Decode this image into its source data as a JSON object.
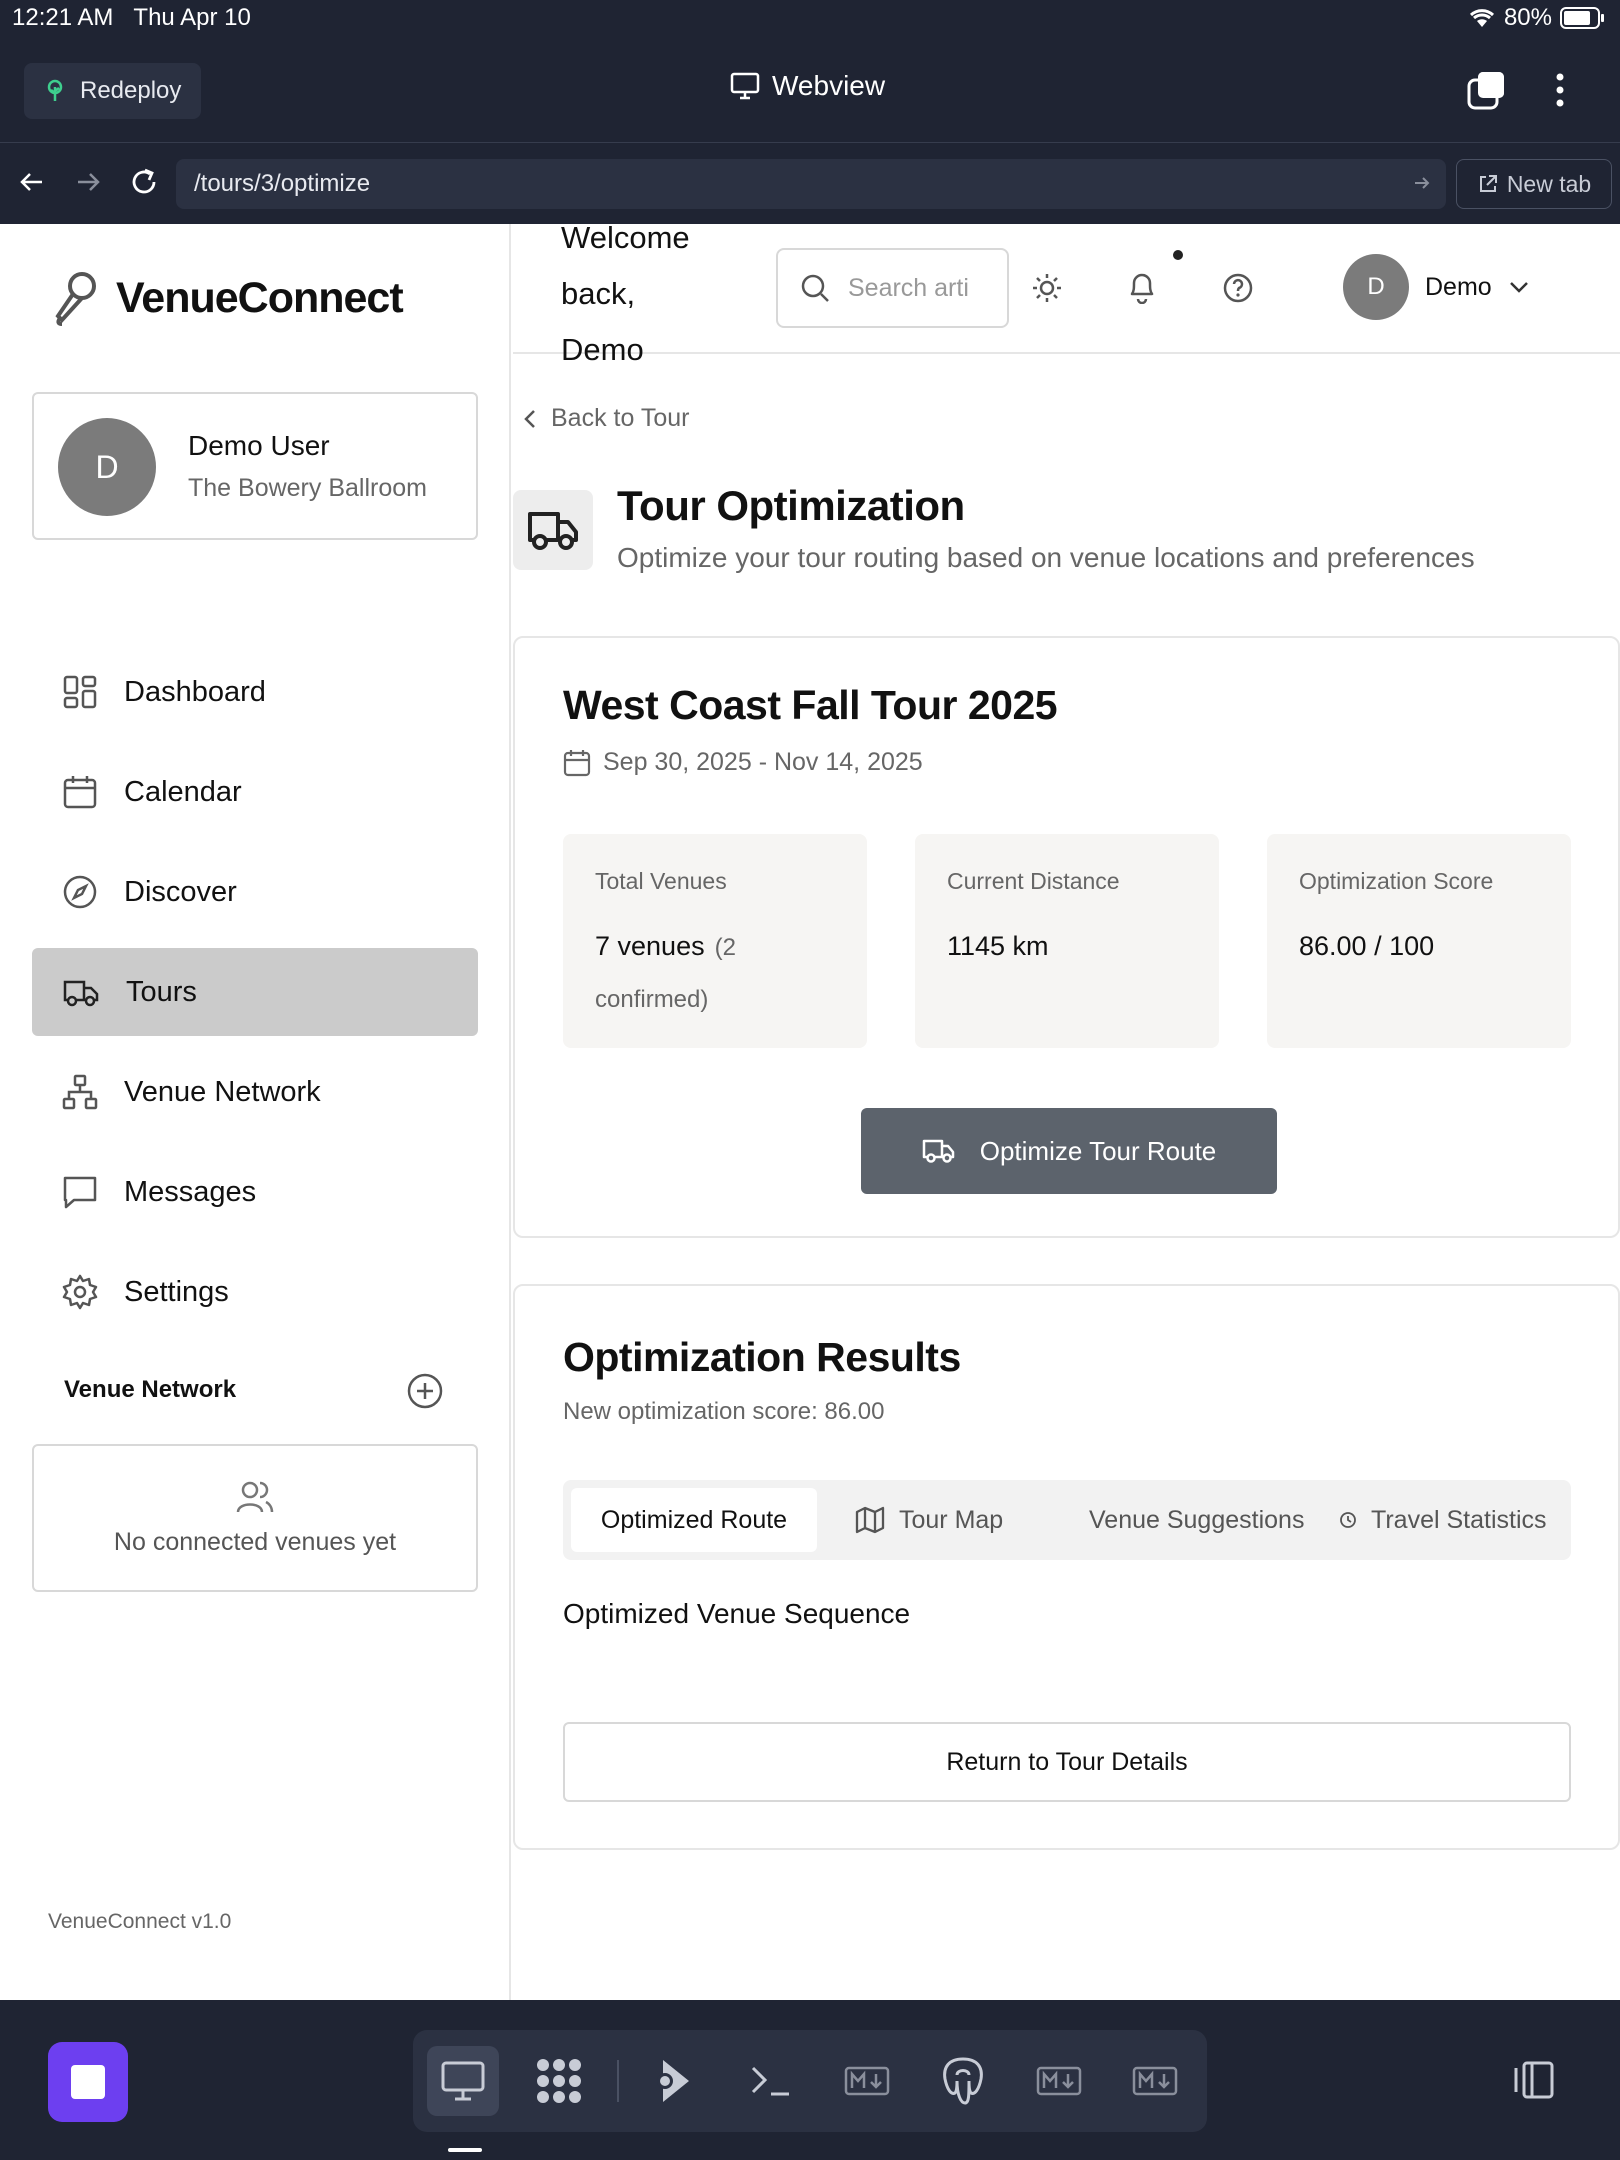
{
  "status_bar": {
    "time": "12:21 AM",
    "date": "Thu Apr 10",
    "battery": "80%"
  },
  "app_header": {
    "redeploy_label": "Redeploy",
    "title": "Webview",
    "accent_color": "#6d3ff0"
  },
  "url_bar": {
    "url": "/tours/3/optimize",
    "new_tab_label": "New tab"
  },
  "sidebar": {
    "brand": "VenueConnect",
    "user": {
      "initial": "D",
      "name": "Demo User",
      "venue": "The Bowery Ballroom"
    },
    "nav": [
      {
        "label": "Dashboard",
        "icon": "dashboard-icon"
      },
      {
        "label": "Calendar",
        "icon": "calendar-icon"
      },
      {
        "label": "Discover",
        "icon": "compass-icon"
      },
      {
        "label": "Tours",
        "icon": "truck-icon",
        "active": true
      },
      {
        "label": "Venue Network",
        "icon": "network-icon"
      },
      {
        "label": "Messages",
        "icon": "message-icon"
      },
      {
        "label": "Settings",
        "icon": "gear-icon"
      }
    ],
    "venue_network": {
      "heading": "Venue Network",
      "empty_text": "No connected venues yet"
    },
    "version": "VenueConnect v1.0"
  },
  "topbar": {
    "welcome": "Welcome back, Demo",
    "search_placeholder": "Search artists",
    "user_initial": "D",
    "user_name": "Demo"
  },
  "page": {
    "back_label": "Back to Tour",
    "title": "Tour Optimization",
    "subtitle": "Optimize your tour routing based on venue locations and preferences"
  },
  "tour": {
    "name": "West Coast Fall Tour 2025",
    "dates": "Sep 30, 2025 - Nov 14, 2025",
    "stats": [
      {
        "label": "Total Venues",
        "value": "7 venues",
        "sub": "(2 confirmed)"
      },
      {
        "label": "Current Distance",
        "value": "1145 km"
      },
      {
        "label": "Optimization Score",
        "value": "86.00 / 100"
      }
    ],
    "optimize_button": "Optimize Tour Route"
  },
  "results": {
    "title": "Optimization Results",
    "score_text": "New optimization score: 86.00",
    "tabs": [
      {
        "label": "Optimized Route",
        "active": true
      },
      {
        "label": "Tour Map",
        "icon": "map-icon"
      },
      {
        "label": "Venue Suggestions"
      },
      {
        "label": "Travel Statistics",
        "icon": "clock-icon"
      }
    ],
    "sequence_title": "Optimized Venue Sequence",
    "return_button": "Return to Tour Details"
  },
  "dock": {
    "items": [
      "monitor-icon",
      "apps-grid-icon",
      "deploy-icon",
      "terminal-icon",
      "markdown-icon",
      "postgres-icon",
      "markdown-icon",
      "markdown-icon"
    ]
  }
}
